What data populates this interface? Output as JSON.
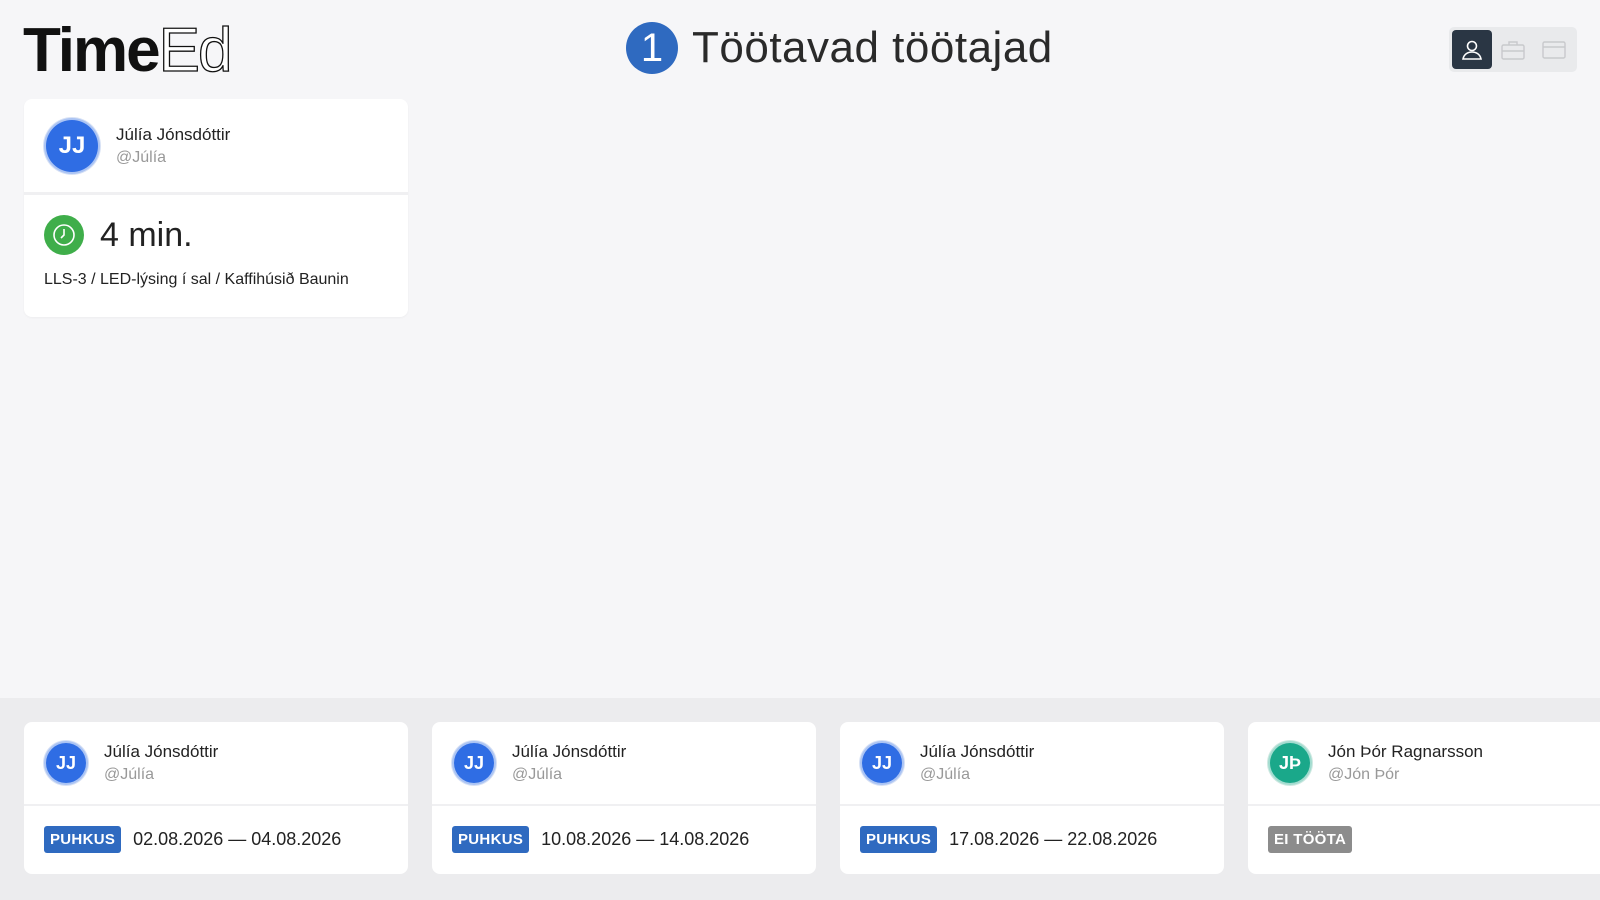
{
  "header": {
    "logo_bold": "Time",
    "logo_light": "Ed",
    "count": "1",
    "title": "Töötavad töötajad",
    "view_switch": [
      {
        "icon": "user-icon",
        "active": true
      },
      {
        "icon": "briefcase-icon",
        "active": false
      },
      {
        "icon": "card-icon",
        "active": false
      }
    ]
  },
  "active_card": {
    "initials": "JJ",
    "name": "Júlía Jónsdóttir",
    "handle": "@Júlía",
    "icon": "clock-icon",
    "duration": "4 min.",
    "task": "LLS-3 / LED-lýsing í sal / Kaffihúsið Baunin"
  },
  "schedule": [
    {
      "initials": "JJ",
      "name": "Júlía Jónsdóttir",
      "handle": "@Júlía",
      "tag": "PUHKUS",
      "dates": "02.08.2026 — 04.08.2026",
      "color": "#2f6de4"
    },
    {
      "initials": "JJ",
      "name": "Júlía Jónsdóttir",
      "handle": "@Júlía",
      "tag": "PUHKUS",
      "dates": "10.08.2026 — 14.08.2026",
      "color": "#2f6de4"
    },
    {
      "initials": "JJ",
      "name": "Júlía Jónsdóttir",
      "handle": "@Júlía",
      "tag": "PUHKUS",
      "dates": "17.08.2026 — 22.08.2026",
      "color": "#2f6de4"
    },
    {
      "initials": "JÞ",
      "name": "Jón Þór Ragnarsson",
      "handle": "@Jón Þór",
      "tag": "EI TÖÖTA",
      "dates": "",
      "color": "#1aa88a"
    }
  ]
}
